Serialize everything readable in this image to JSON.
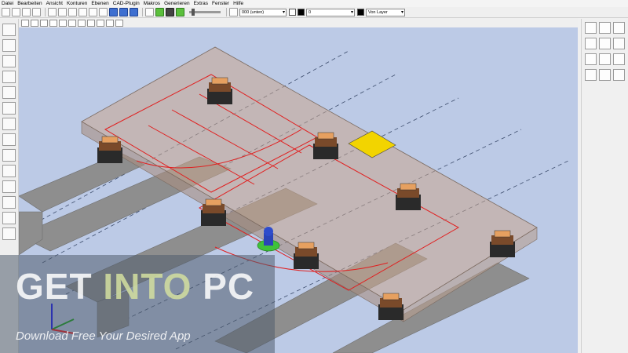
{
  "menu": [
    "Datei",
    "Bearbeiten",
    "Ansicht",
    "Konturen",
    "Ebenen",
    "CAD-Plugin",
    "Makros",
    "Generieren",
    "Extras",
    "Fenster",
    "Hilfe"
  ],
  "toolbar": {
    "layer_value": "000 (unten)",
    "color_value": "0",
    "linetype_value": "Von Layer"
  },
  "watermark": {
    "title_get": "GET",
    "title_into": "INTO",
    "title_pc": "PC",
    "subtitle": "Download Free Your Desired App"
  },
  "viewport": {
    "background_color": "#bccae6",
    "panel_color": "#c9a58e",
    "contour_color": "#e02020",
    "axis_colors": {
      "x": "#ff0000",
      "y": "#00a000",
      "z": "#0000ff"
    }
  },
  "icons": {
    "left_toolbar": [
      "select-arrow-icon",
      "rotate-icon",
      "measure-icon",
      "column-icon",
      "text-tool-icon",
      "pin-icon",
      "circle-tool-icon",
      "rectangle-tool-icon",
      "document-icon",
      "zoom-icon",
      "settings-icon",
      "cube-icon",
      "pen-tool-icon",
      "layers-icon"
    ],
    "right_toolbar": [
      "pointer-icon",
      "line-icon",
      "angle-icon",
      "arc-icon",
      "dimension-icon",
      "polyline-icon",
      "circle-icon",
      "spline-icon",
      "text-icon",
      "text-3d-icon",
      "align-icon",
      "scale-icon"
    ]
  }
}
